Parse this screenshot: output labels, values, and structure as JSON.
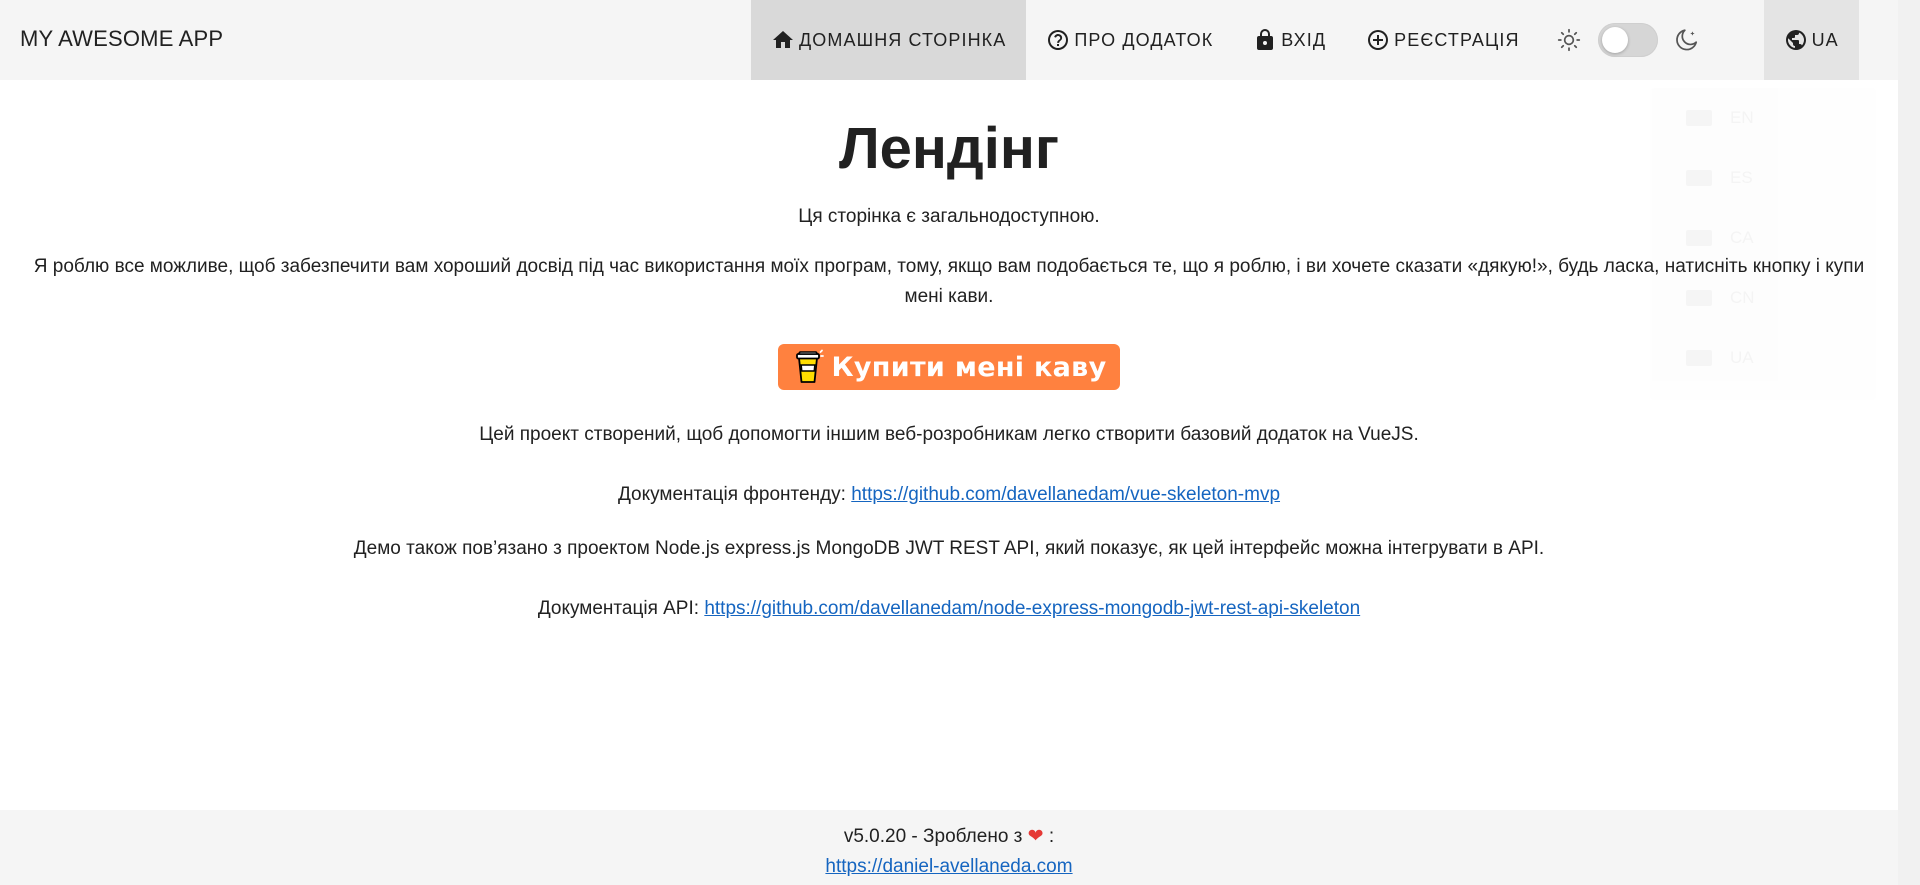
{
  "header": {
    "app_title": "MY AWESOME APP",
    "nav": {
      "home": "ДОМАШНЯ СТОРІНКА",
      "about": "ПРО ДОДАТОК",
      "login": "ВХІД",
      "signup": "РЕЄСТРАЦІЯ"
    },
    "language": "UA"
  },
  "language_menu": {
    "items": [
      "EN",
      "ES",
      "CA",
      "CN",
      "UA"
    ]
  },
  "main": {
    "title": "Лендінг",
    "public_note": "Ця сторінка є загальнодоступною.",
    "intro": "Я роблю все можливе, щоб забезпечити вам хороший досвід під час використання моїх програм, тому, якщо вам подобається те, що я роблю, і ви хочете сказати «дякую!», будь ласка, натисніть кнопку і купи мені кави.",
    "coffee_button": "Купити мені каву",
    "project_text": "Цей проект створений, щоб допомогти іншим веб-розробникам легко створити базовий додаток на VueJS.",
    "frontend_docs_label": "Документація фронтенду:",
    "frontend_docs_url": "https://github.com/davellanedam/vue-skeleton-mvp",
    "demo_text": "Демо також пов’язано з проектом Node.js express.js MongoDB JWT REST API, який показує, як цей інтерфейс можна інтегрувати в API.",
    "api_docs_label": "Документація API:",
    "api_docs_url": "https://github.com/davellanedam/node-express-mongodb-jwt-rest-api-skeleton"
  },
  "footer": {
    "version_text": "v5.0.20 - Зроблено з",
    "heart": "❤",
    "colon": ":",
    "author_url": "https://daniel-avellaneda.com"
  },
  "colors": {
    "toolbar_bg": "#f5f5f5",
    "active_nav_bg": "#d9d9d9",
    "coffee_button_bg": "#ff813f",
    "link": "#1565c0",
    "heart": "#e53935"
  }
}
